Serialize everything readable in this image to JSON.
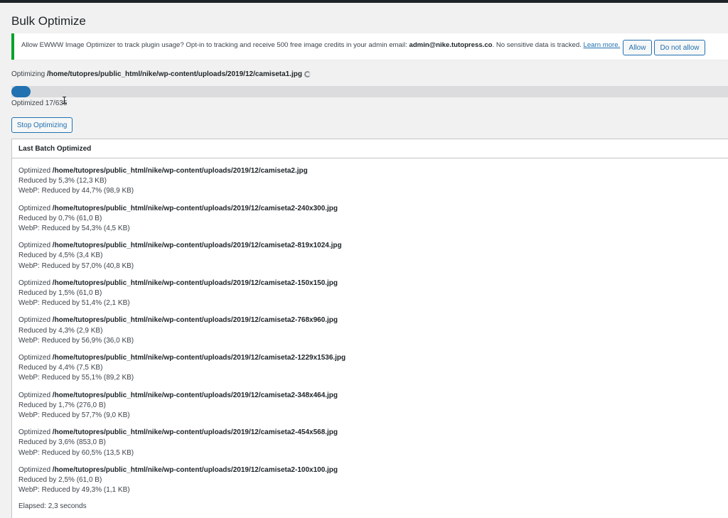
{
  "page": {
    "title": "Bulk Optimize"
  },
  "notice": {
    "text_before": "Allow EWWW Image Optimizer to track plugin usage? Opt-in to tracking and receive 500 free image credits in your admin email: ",
    "email": "admin@nike.tutopress.co",
    "text_after": ". No sensitive data is tracked. ",
    "learn_more": "Learn more.",
    "allow_label": "Allow",
    "deny_label": "Do not allow"
  },
  "status": {
    "optimizing_prefix": "Optimizing ",
    "current_file": "/home/tutopres/public_html/nike/wp-content/uploads/2019/12/camiseta1.jpg",
    "progress_fraction": 0.027,
    "count_text": "Optimized 17/635",
    "stop_label": "Stop Optimizing"
  },
  "batch": {
    "header": "Last Batch Optimized",
    "optimized_prefix": "Optimized ",
    "entries": [
      {
        "path": "/home/tutopres/public_html/nike/wp-content/uploads/2019/12/camiseta2.jpg",
        "reduced": "Reduced by 5,3% (12,3 KB)",
        "webp": "WebP: Reduced by 44,7% (98,9 KB)"
      },
      {
        "path": "/home/tutopres/public_html/nike/wp-content/uploads/2019/12/camiseta2-240x300.jpg",
        "reduced": "Reduced by 0,7% (61,0 B)",
        "webp": "WebP: Reduced by 54,3% (4,5 KB)"
      },
      {
        "path": "/home/tutopres/public_html/nike/wp-content/uploads/2019/12/camiseta2-819x1024.jpg",
        "reduced": "Reduced by 4,5% (3,4 KB)",
        "webp": "WebP: Reduced by 57,0% (40,8 KB)"
      },
      {
        "path": "/home/tutopres/public_html/nike/wp-content/uploads/2019/12/camiseta2-150x150.jpg",
        "reduced": "Reduced by 1,5% (61,0 B)",
        "webp": "WebP: Reduced by 51,4% (2,1 KB)"
      },
      {
        "path": "/home/tutopres/public_html/nike/wp-content/uploads/2019/12/camiseta2-768x960.jpg",
        "reduced": "Reduced by 4,3% (2,9 KB)",
        "webp": "WebP: Reduced by 56,9% (36,0 KB)"
      },
      {
        "path": "/home/tutopres/public_html/nike/wp-content/uploads/2019/12/camiseta2-1229x1536.jpg",
        "reduced": "Reduced by 4,4% (7,5 KB)",
        "webp": "WebP: Reduced by 55,1% (89,2 KB)"
      },
      {
        "path": "/home/tutopres/public_html/nike/wp-content/uploads/2019/12/camiseta2-348x464.jpg",
        "reduced": "Reduced by 1,7% (276,0 B)",
        "webp": "WebP: Reduced by 57,7% (9,0 KB)"
      },
      {
        "path": "/home/tutopres/public_html/nike/wp-content/uploads/2019/12/camiseta2-454x568.jpg",
        "reduced": "Reduced by 3,6% (853,0 B)",
        "webp": "WebP: Reduced by 60,5% (13,5 KB)"
      },
      {
        "path": "/home/tutopres/public_html/nike/wp-content/uploads/2019/12/camiseta2-100x100.jpg",
        "reduced": "Reduced by 2,5% (61,0 B)",
        "webp": "WebP: Reduced by 49,3% (1,1 KB)"
      }
    ],
    "elapsed": "Elapsed: 2,3 seconds"
  },
  "colors": {
    "accent": "#2271b1",
    "notice_border": "#00a32a",
    "background": "#f1f1f1"
  }
}
